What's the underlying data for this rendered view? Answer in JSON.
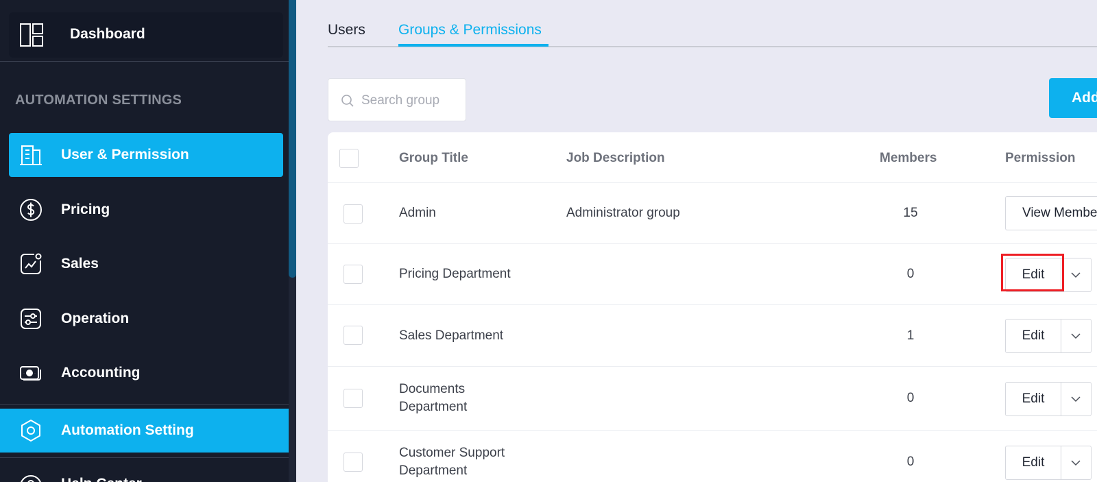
{
  "sidebar": {
    "dashboard_label": "Dashboard",
    "section_title": "AUTOMATION SETTINGS",
    "items": [
      {
        "label": "User & Permission",
        "icon": "building-icon",
        "active": true
      },
      {
        "label": "Pricing",
        "icon": "dollar-circle-icon",
        "active": false
      },
      {
        "label": "Sales",
        "icon": "chart-trend-icon",
        "active": false
      },
      {
        "label": "Operation",
        "icon": "sliders-icon",
        "active": false
      },
      {
        "label": "Accounting",
        "icon": "money-icon",
        "active": false
      }
    ],
    "automation_label": "Automation Setting",
    "help_label": "Help Center"
  },
  "tabs": [
    {
      "label": "Users",
      "active": false
    },
    {
      "label": "Groups & Permissions",
      "active": true
    }
  ],
  "search": {
    "placeholder": "Search group"
  },
  "add_label": "Add",
  "table": {
    "headers": {
      "group_title": "Group Title",
      "job_description": "Job Description",
      "members": "Members",
      "permission": "Permission"
    },
    "rows": [
      {
        "title": "Admin",
        "description": "Administrator group",
        "members": "15",
        "action": "View Members"
      },
      {
        "title": "Pricing Department",
        "description": "",
        "members": "0",
        "action": "Edit"
      },
      {
        "title": "Sales Department",
        "description": "",
        "members": "1",
        "action": "Edit"
      },
      {
        "title": "Documents Department",
        "description": "",
        "members": "0",
        "action": "Edit"
      },
      {
        "title": "Customer Support Department",
        "description": "",
        "members": "0",
        "action": "Edit"
      }
    ]
  },
  "colors": {
    "accent": "#0db1ee",
    "sidebar_bg": "#171c2a",
    "highlight": "#ee1f25"
  }
}
